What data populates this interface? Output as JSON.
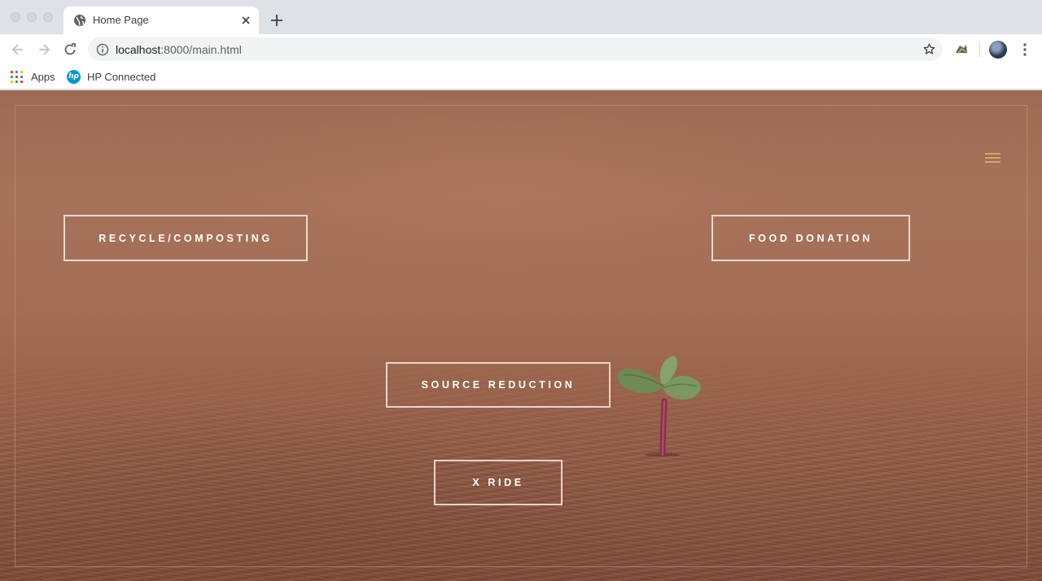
{
  "browser": {
    "tab": {
      "title": "Home Page"
    },
    "address_bar": {
      "host": "localhost",
      "path": ":8000/main.html"
    },
    "bookmarks": [
      {
        "label": "Apps",
        "icon": "apps-grid-icon"
      },
      {
        "label": "HP Connected",
        "icon": "hp-logo-icon"
      }
    ]
  },
  "page": {
    "menu_icon": "hamburger-menu-icon",
    "nav_links": [
      {
        "label": "RECYCLE/COMPOSTING"
      },
      {
        "label": "FOOD DONATION"
      },
      {
        "label": "SOURCE REDUCTION"
      },
      {
        "label": "X RIDE"
      }
    ],
    "background_image": "sprout-in-soil",
    "colors": {
      "menu_accent": "#d8a46a",
      "frame_border": "#cd9b6e",
      "button_border": "#f5ebe4"
    }
  }
}
